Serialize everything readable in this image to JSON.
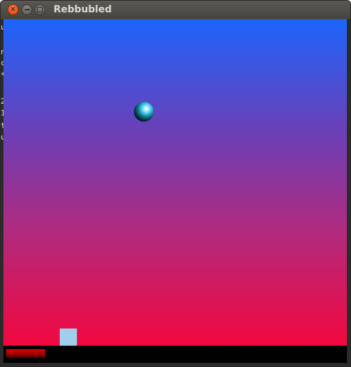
{
  "window": {
    "title": "Rebbubled",
    "close_glyph": "×"
  },
  "terminal_strip": {
    "chars": [
      "u",
      "n",
      "c",
      "*",
      "2",
      "1",
      "t",
      "u"
    ]
  },
  "game": {
    "background_top": "#1d65fb",
    "background_bottom": "#f3083f",
    "ball_color": "#3fc6e6",
    "paddle_color": "#9fcfed"
  },
  "hud": {
    "health_color": "#e00000"
  },
  "icons": {
    "close": "close-icon",
    "minimize": "minimize-icon",
    "maximize": "maximize-icon"
  }
}
